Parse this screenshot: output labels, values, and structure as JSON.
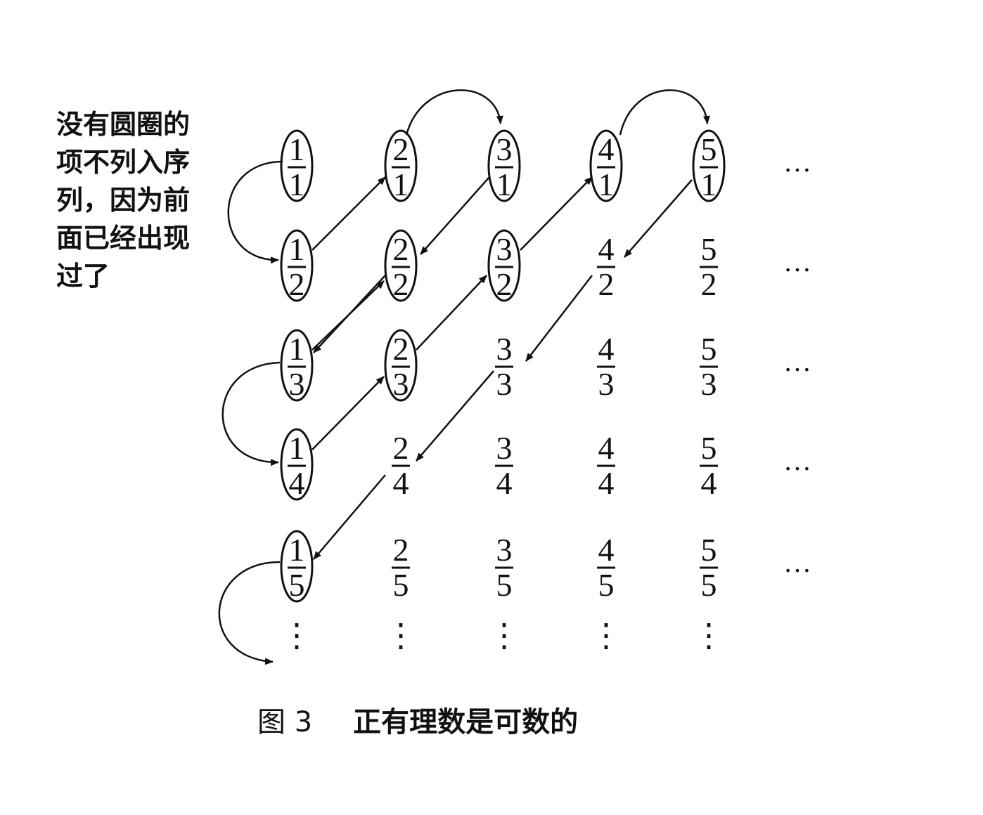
{
  "note": "没有圆圈的\n项不列入序\n列，因为前\n面已经出现\n过了",
  "caption": {
    "figure_number": "图 3",
    "title": "正有理数是可数的"
  },
  "ellipsis_horizontal": "…",
  "ellipsis_vertical": "⋮",
  "grid": {
    "rows": [
      [
        {
          "num": "1",
          "den": "1",
          "circled": true
        },
        {
          "num": "2",
          "den": "1",
          "circled": true
        },
        {
          "num": "3",
          "den": "1",
          "circled": true
        },
        {
          "num": "4",
          "den": "1",
          "circled": true
        },
        {
          "num": "5",
          "den": "1",
          "circled": true
        }
      ],
      [
        {
          "num": "1",
          "den": "2",
          "circled": true
        },
        {
          "num": "2",
          "den": "2",
          "circled": true
        },
        {
          "num": "3",
          "den": "2",
          "circled": true
        },
        {
          "num": "4",
          "den": "2",
          "circled": false
        },
        {
          "num": "5",
          "den": "2",
          "circled": false
        }
      ],
      [
        {
          "num": "1",
          "den": "3",
          "circled": true
        },
        {
          "num": "2",
          "den": "3",
          "circled": true
        },
        {
          "num": "3",
          "den": "3",
          "circled": false
        },
        {
          "num": "4",
          "den": "3",
          "circled": false
        },
        {
          "num": "5",
          "den": "3",
          "circled": false
        }
      ],
      [
        {
          "num": "1",
          "den": "4",
          "circled": true
        },
        {
          "num": "2",
          "den": "4",
          "circled": false
        },
        {
          "num": "3",
          "den": "4",
          "circled": false
        },
        {
          "num": "4",
          "den": "4",
          "circled": false
        },
        {
          "num": "5",
          "den": "4",
          "circled": false
        }
      ],
      [
        {
          "num": "1",
          "den": "5",
          "circled": true
        },
        {
          "num": "2",
          "den": "5",
          "circled": false
        },
        {
          "num": "3",
          "den": "5",
          "circled": false
        },
        {
          "num": "4",
          "den": "5",
          "circled": false
        },
        {
          "num": "5",
          "den": "5",
          "circled": false
        }
      ]
    ]
  }
}
